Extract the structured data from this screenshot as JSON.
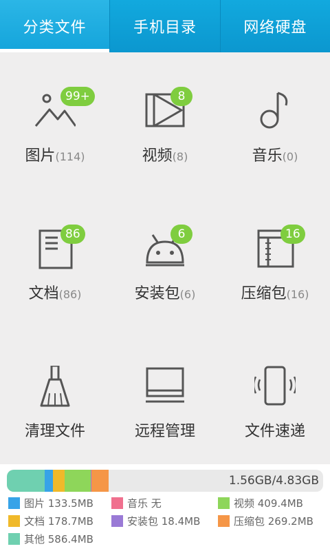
{
  "tabs": [
    {
      "label": "分类文件",
      "active": true
    },
    {
      "label": "手机目录",
      "active": false
    },
    {
      "label": "网络硬盘",
      "active": false
    }
  ],
  "categories": [
    {
      "label": "图片",
      "count": "(114)",
      "badge": "99+",
      "icon": "image-icon"
    },
    {
      "label": "视频",
      "count": "(8)",
      "badge": "8",
      "icon": "video-icon"
    },
    {
      "label": "音乐",
      "count": "(0)",
      "badge": "",
      "icon": "music-note-icon"
    },
    {
      "label": "文档",
      "count": "(86)",
      "badge": "86",
      "icon": "document-icon"
    },
    {
      "label": "安装包",
      "count": "(6)",
      "badge": "6",
      "icon": "android-icon"
    },
    {
      "label": "压缩包",
      "count": "(16)",
      "badge": "16",
      "icon": "archive-icon"
    },
    {
      "label": "清理文件",
      "count": "",
      "badge": "",
      "icon": "broom-icon"
    },
    {
      "label": "远程管理",
      "count": "",
      "badge": "",
      "icon": "monitor-icon"
    },
    {
      "label": "文件速递",
      "count": "",
      "badge": "",
      "icon": "phone-vibrate-icon"
    }
  ],
  "storage": {
    "used_text": "1.56GB/4.83GB",
    "segments": [
      {
        "name": "其他",
        "size_mb": 586.4,
        "color": "#6fd0b0"
      },
      {
        "name": "图片",
        "size_mb": 133.5,
        "color": "#37a3e8"
      },
      {
        "name": "文档",
        "size_mb": 178.7,
        "color": "#f0b92a"
      },
      {
        "name": "视频",
        "size_mb": 409.4,
        "color": "#8ed65a"
      },
      {
        "name": "安装包",
        "size_mb": 18.4,
        "color": "#9a7ad6"
      },
      {
        "name": "压缩包",
        "size_mb": 269.2,
        "color": "#f59647"
      }
    ],
    "total_mb": 4946,
    "legend": [
      {
        "label": "图片 133.5MB",
        "color": "#37a3e8"
      },
      {
        "label": "音乐 无",
        "color": "#f0708e"
      },
      {
        "label": "视频 409.4MB",
        "color": "#8ed65a"
      },
      {
        "label": "文档 178.7MB",
        "color": "#f0b92a"
      },
      {
        "label": "安装包 18.4MB",
        "color": "#9a7ad6"
      },
      {
        "label": "压缩包 269.2MB",
        "color": "#f59647"
      },
      {
        "label": "其他 586.4MB",
        "color": "#6fd0b0"
      }
    ]
  },
  "colors": {
    "tab_bg": "#0b97cf",
    "badge": "#7fcd3f",
    "icon_stroke": "#555555"
  }
}
